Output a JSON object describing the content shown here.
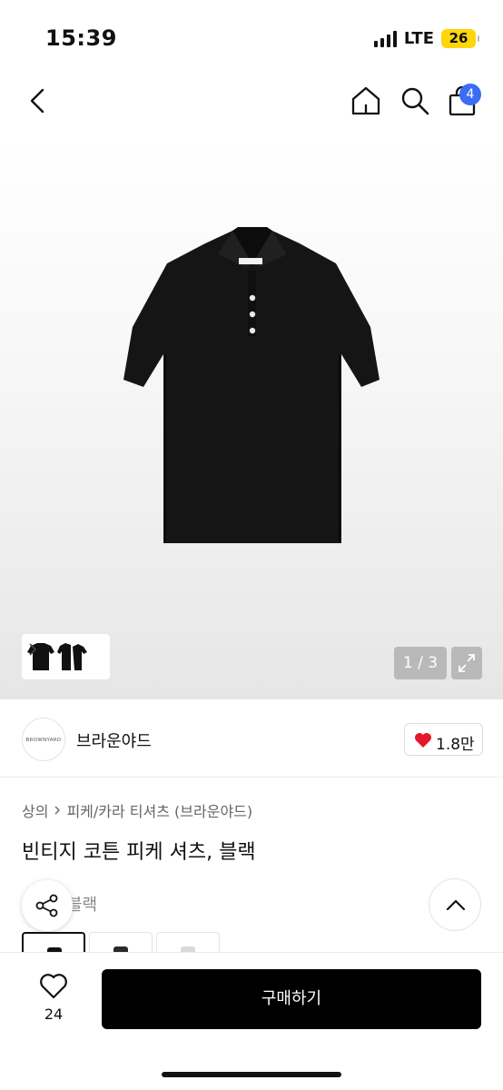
{
  "status_bar": {
    "time": "15:39",
    "network": "LTE",
    "battery": "26",
    "signal_bars": 4
  },
  "nav": {
    "cart_count": "4",
    "icons": [
      "back-arrow-icon",
      "home-icon",
      "search-icon",
      "shopping-bag-icon"
    ]
  },
  "gallery": {
    "counter": "1 / 3",
    "current_image": 1,
    "total_images": 3
  },
  "brand": {
    "name": "브라운야드",
    "logo_text": "BROWNYARD",
    "likes": "1.8만"
  },
  "product": {
    "breadcrumb": [
      "상의",
      "피케/카라 티셔츠 (브라운야드)"
    ],
    "title": "빈티지 코튼 피케 셔츠, 블랙",
    "partially_hidden_text": "블랙",
    "option_colors": [
      "#111111",
      "#2a2a2a",
      "#d9d9d9"
    ]
  },
  "bottom_bar": {
    "wish_count": "24",
    "buy_label": "구매하기"
  },
  "colors": {
    "badge": "#3b6cf6",
    "like_heart": "#e5162b",
    "battery": "#ffd60a",
    "buy_button": "#000000"
  }
}
